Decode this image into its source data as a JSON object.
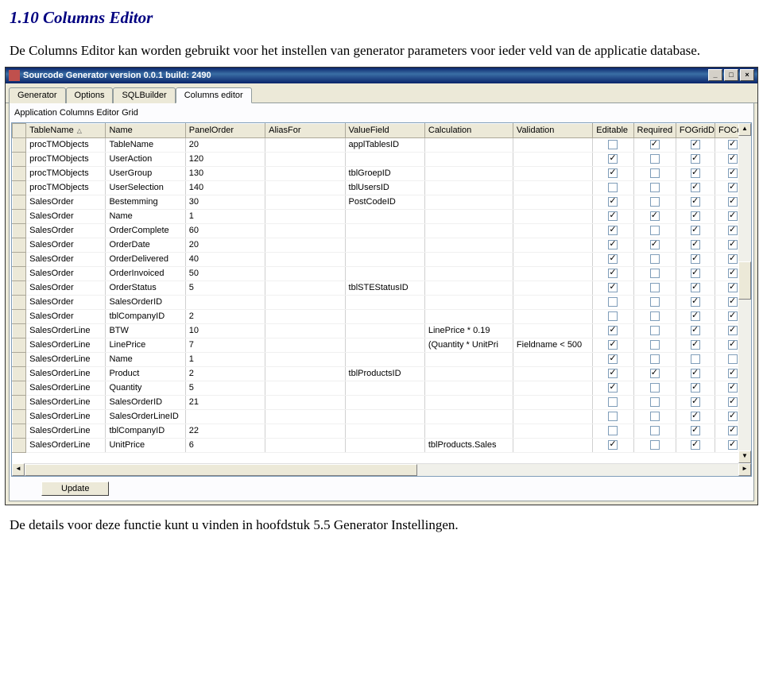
{
  "doc": {
    "heading": "1.10 Columns Editor",
    "intro": "De Columns Editor kan worden gebruikt voor het instellen van generator parameters voor ieder veld van de applicatie database.",
    "outro": "De details voor deze functie kunt u vinden in hoofdstuk 5.5 Generator Instellingen."
  },
  "window": {
    "title": "Sourcode Generator version 0.0.1 build: 2490",
    "min": "_",
    "max": "□",
    "close": "×"
  },
  "tabs": [
    "Generator",
    "Options",
    "SQLBuilder",
    "Columns editor"
  ],
  "active_tab": 3,
  "panel_label": "Application Columns Editor Grid",
  "columns": [
    "TableName",
    "Name",
    "PanelOrder",
    "AliasFor",
    "ValueField",
    "Calculation",
    "Validation",
    "Editable",
    "Required",
    "FOGridD",
    "FOContA"
  ],
  "sort_col": 0,
  "rows": [
    {
      "table": "procTMObjects",
      "name": "TableName",
      "panel": "20",
      "alias": "",
      "valuef": "applTablesID",
      "calc": "",
      "valid": "",
      "editable": false,
      "required": true,
      "fogrid": true,
      "foconta": true
    },
    {
      "table": "procTMObjects",
      "name": "UserAction",
      "panel": "120",
      "alias": "",
      "valuef": "",
      "calc": "",
      "valid": "",
      "editable": true,
      "required": false,
      "fogrid": true,
      "foconta": true
    },
    {
      "table": "procTMObjects",
      "name": "UserGroup",
      "panel": "130",
      "alias": "",
      "valuef": "tblGroepID",
      "calc": "",
      "valid": "",
      "editable": true,
      "required": false,
      "fogrid": true,
      "foconta": true
    },
    {
      "table": "procTMObjects",
      "name": "UserSelection",
      "panel": "140",
      "alias": "",
      "valuef": "tblUsersID",
      "calc": "",
      "valid": "",
      "editable": false,
      "required": false,
      "fogrid": true,
      "foconta": true
    },
    {
      "table": "SalesOrder",
      "name": "Bestemming",
      "panel": "30",
      "alias": "",
      "valuef": "PostCodeID",
      "calc": "",
      "valid": "",
      "editable": true,
      "required": false,
      "fogrid": true,
      "foconta": true
    },
    {
      "table": "SalesOrder",
      "name": "Name",
      "panel": "1",
      "alias": "",
      "valuef": "",
      "calc": "",
      "valid": "",
      "editable": true,
      "required": true,
      "fogrid": true,
      "foconta": true
    },
    {
      "table": "SalesOrder",
      "name": "OrderComplete",
      "panel": "60",
      "alias": "",
      "valuef": "",
      "calc": "",
      "valid": "",
      "editable": true,
      "required": false,
      "fogrid": true,
      "foconta": true
    },
    {
      "table": "SalesOrder",
      "name": "OrderDate",
      "panel": "20",
      "alias": "",
      "valuef": "",
      "calc": "",
      "valid": "",
      "editable": true,
      "required": true,
      "fogrid": true,
      "foconta": true
    },
    {
      "table": "SalesOrder",
      "name": "OrderDelivered",
      "panel": "40",
      "alias": "",
      "valuef": "",
      "calc": "",
      "valid": "",
      "editable": true,
      "required": false,
      "fogrid": true,
      "foconta": true
    },
    {
      "table": "SalesOrder",
      "name": "OrderInvoiced",
      "panel": "50",
      "alias": "",
      "valuef": "",
      "calc": "",
      "valid": "",
      "editable": true,
      "required": false,
      "fogrid": true,
      "foconta": true
    },
    {
      "table": "SalesOrder",
      "name": "OrderStatus",
      "panel": "5",
      "alias": "",
      "valuef": "tblSTEStatusID",
      "calc": "",
      "valid": "",
      "editable": true,
      "required": false,
      "fogrid": true,
      "foconta": true
    },
    {
      "table": "SalesOrder",
      "name": "SalesOrderID",
      "panel": "",
      "alias": "",
      "valuef": "",
      "calc": "",
      "valid": "",
      "editable": false,
      "required": false,
      "fogrid": true,
      "foconta": true
    },
    {
      "table": "SalesOrder",
      "name": "tblCompanyID",
      "panel": "2",
      "alias": "",
      "valuef": "",
      "calc": "",
      "valid": "",
      "editable": false,
      "required": false,
      "fogrid": true,
      "foconta": true
    },
    {
      "table": "SalesOrderLine",
      "name": "BTW",
      "panel": "10",
      "alias": "",
      "valuef": "",
      "calc": "LinePrice * 0.19",
      "valid": "",
      "editable": true,
      "required": false,
      "fogrid": true,
      "foconta": true
    },
    {
      "table": "SalesOrderLine",
      "name": "LinePrice",
      "panel": "7",
      "alias": "",
      "valuef": "",
      "calc": "(Quantity * UnitPri",
      "valid": "Fieldname < 500",
      "editable": true,
      "required": false,
      "fogrid": true,
      "foconta": true
    },
    {
      "table": "SalesOrderLine",
      "name": "Name",
      "panel": "1",
      "alias": "",
      "valuef": "",
      "calc": "",
      "valid": "",
      "editable": true,
      "required": false,
      "fogrid": false,
      "foconta": false
    },
    {
      "table": "SalesOrderLine",
      "name": "Product",
      "panel": "2",
      "alias": "",
      "valuef": "tblProductsID",
      "calc": "",
      "valid": "",
      "editable": true,
      "required": true,
      "fogrid": true,
      "foconta": true
    },
    {
      "table": "SalesOrderLine",
      "name": "Quantity",
      "panel": "5",
      "alias": "",
      "valuef": "",
      "calc": "",
      "valid": "",
      "editable": true,
      "required": false,
      "fogrid": true,
      "foconta": true
    },
    {
      "table": "SalesOrderLine",
      "name": "SalesOrderID",
      "panel": "21",
      "alias": "",
      "valuef": "",
      "calc": "",
      "valid": "",
      "editable": false,
      "required": false,
      "fogrid": true,
      "foconta": true
    },
    {
      "table": "SalesOrderLine",
      "name": "SalesOrderLineID",
      "panel": "",
      "alias": "",
      "valuef": "",
      "calc": "",
      "valid": "",
      "editable": false,
      "required": false,
      "fogrid": true,
      "foconta": true
    },
    {
      "table": "SalesOrderLine",
      "name": "tblCompanyID",
      "panel": "22",
      "alias": "",
      "valuef": "",
      "calc": "",
      "valid": "",
      "editable": false,
      "required": false,
      "fogrid": true,
      "foconta": true
    },
    {
      "table": "SalesOrderLine",
      "name": "UnitPrice",
      "panel": "6",
      "alias": "",
      "valuef": "",
      "calc": "tblProducts.Sales",
      "valid": "",
      "editable": true,
      "required": false,
      "fogrid": true,
      "foconta": true
    }
  ],
  "update_label": "Update",
  "scroll": {
    "left": "◄",
    "right": "►",
    "up": "▲",
    "down": "▼"
  }
}
